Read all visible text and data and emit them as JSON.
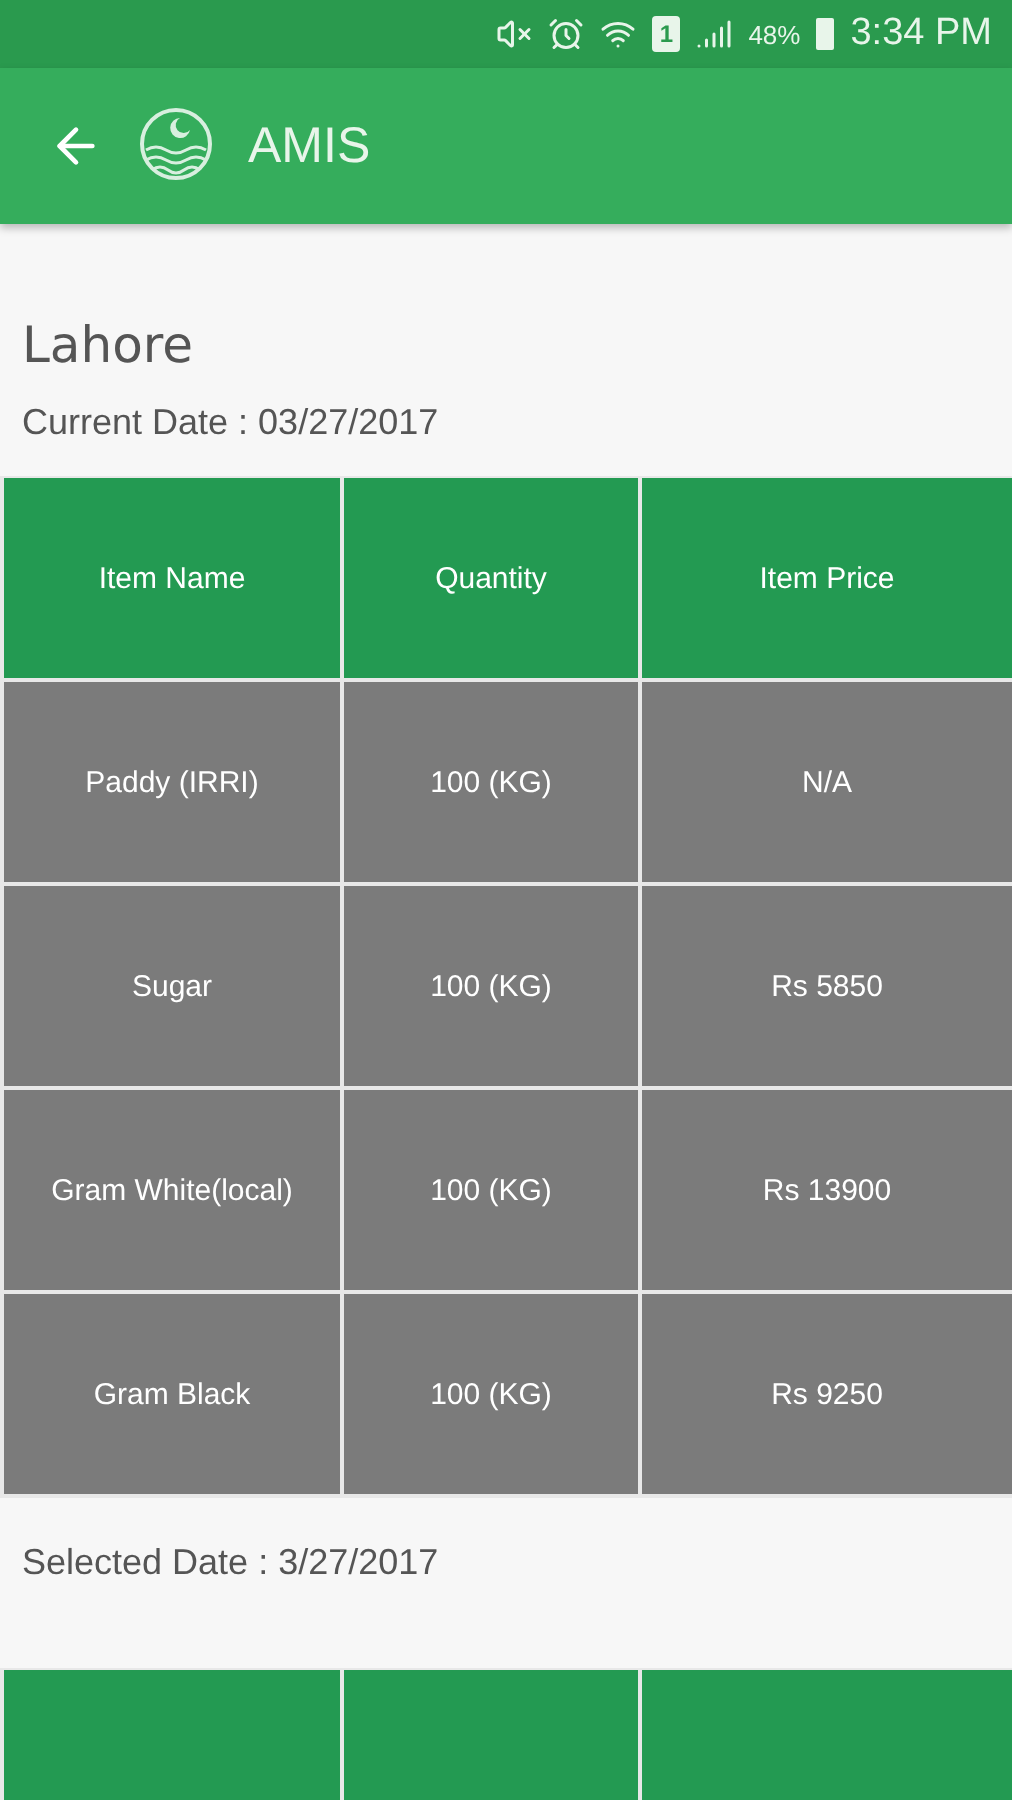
{
  "status_bar": {
    "sim": "1",
    "battery": "48%",
    "time": "3:34 PM"
  },
  "app_bar": {
    "title": "AMIS"
  },
  "city": "Lahore",
  "current_date": "Current Date : 03/27/2017",
  "table": {
    "columns": [
      "Item Name",
      "Quantity",
      "Item Price"
    ],
    "rows": [
      [
        "Paddy (IRRI)",
        "100 (KG)",
        "N/A"
      ],
      [
        "Sugar",
        "100 (KG)",
        "Rs 5850"
      ],
      [
        "Gram White(local)",
        "100 (KG)",
        "Rs 13900"
      ],
      [
        "Gram Black",
        "100 (KG)",
        "Rs 9250"
      ]
    ]
  },
  "selected_date": "Selected Date : 3/27/2017"
}
